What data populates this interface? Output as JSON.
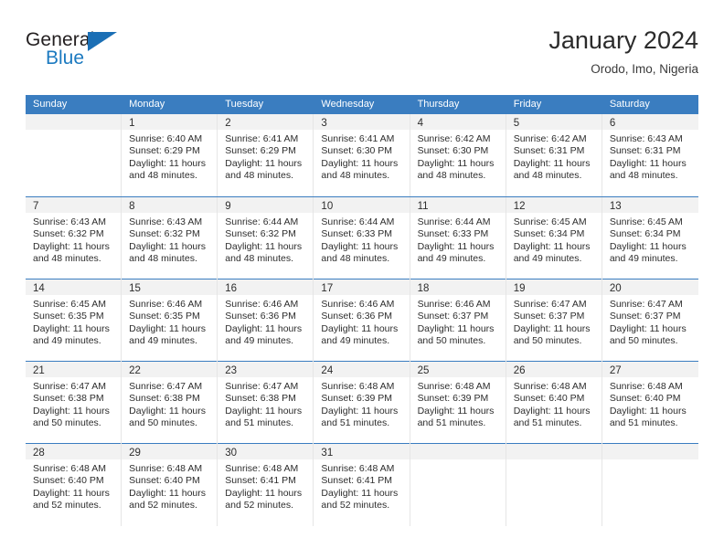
{
  "brand": {
    "name_part1": "General",
    "name_part2": "Blue",
    "logo_icon": "blue-triangle-logo"
  },
  "header": {
    "title": "January 2024",
    "location": "Orodo, Imo, Nigeria"
  },
  "calendar": {
    "weekday_headers": [
      "Sunday",
      "Monday",
      "Tuesday",
      "Wednesday",
      "Thursday",
      "Friday",
      "Saturday"
    ],
    "header_bg_color": "#3a7dc0",
    "daynum_band_color": "#f2f2f2",
    "weeks": [
      [
        {
          "day": "",
          "empty": true,
          "sunrise": "",
          "sunset": "",
          "daylight1": "",
          "daylight2": ""
        },
        {
          "day": "1",
          "sunrise": "Sunrise: 6:40 AM",
          "sunset": "Sunset: 6:29 PM",
          "daylight1": "Daylight: 11 hours",
          "daylight2": "and 48 minutes."
        },
        {
          "day": "2",
          "sunrise": "Sunrise: 6:41 AM",
          "sunset": "Sunset: 6:29 PM",
          "daylight1": "Daylight: 11 hours",
          "daylight2": "and 48 minutes."
        },
        {
          "day": "3",
          "sunrise": "Sunrise: 6:41 AM",
          "sunset": "Sunset: 6:30 PM",
          "daylight1": "Daylight: 11 hours",
          "daylight2": "and 48 minutes."
        },
        {
          "day": "4",
          "sunrise": "Sunrise: 6:42 AM",
          "sunset": "Sunset: 6:30 PM",
          "daylight1": "Daylight: 11 hours",
          "daylight2": "and 48 minutes."
        },
        {
          "day": "5",
          "sunrise": "Sunrise: 6:42 AM",
          "sunset": "Sunset: 6:31 PM",
          "daylight1": "Daylight: 11 hours",
          "daylight2": "and 48 minutes."
        },
        {
          "day": "6",
          "sunrise": "Sunrise: 6:43 AM",
          "sunset": "Sunset: 6:31 PM",
          "daylight1": "Daylight: 11 hours",
          "daylight2": "and 48 minutes."
        }
      ],
      [
        {
          "day": "7",
          "sunrise": "Sunrise: 6:43 AM",
          "sunset": "Sunset: 6:32 PM",
          "daylight1": "Daylight: 11 hours",
          "daylight2": "and 48 minutes."
        },
        {
          "day": "8",
          "sunrise": "Sunrise: 6:43 AM",
          "sunset": "Sunset: 6:32 PM",
          "daylight1": "Daylight: 11 hours",
          "daylight2": "and 48 minutes."
        },
        {
          "day": "9",
          "sunrise": "Sunrise: 6:44 AM",
          "sunset": "Sunset: 6:32 PM",
          "daylight1": "Daylight: 11 hours",
          "daylight2": "and 48 minutes."
        },
        {
          "day": "10",
          "sunrise": "Sunrise: 6:44 AM",
          "sunset": "Sunset: 6:33 PM",
          "daylight1": "Daylight: 11 hours",
          "daylight2": "and 48 minutes."
        },
        {
          "day": "11",
          "sunrise": "Sunrise: 6:44 AM",
          "sunset": "Sunset: 6:33 PM",
          "daylight1": "Daylight: 11 hours",
          "daylight2": "and 49 minutes."
        },
        {
          "day": "12",
          "sunrise": "Sunrise: 6:45 AM",
          "sunset": "Sunset: 6:34 PM",
          "daylight1": "Daylight: 11 hours",
          "daylight2": "and 49 minutes."
        },
        {
          "day": "13",
          "sunrise": "Sunrise: 6:45 AM",
          "sunset": "Sunset: 6:34 PM",
          "daylight1": "Daylight: 11 hours",
          "daylight2": "and 49 minutes."
        }
      ],
      [
        {
          "day": "14",
          "sunrise": "Sunrise: 6:45 AM",
          "sunset": "Sunset: 6:35 PM",
          "daylight1": "Daylight: 11 hours",
          "daylight2": "and 49 minutes."
        },
        {
          "day": "15",
          "sunrise": "Sunrise: 6:46 AM",
          "sunset": "Sunset: 6:35 PM",
          "daylight1": "Daylight: 11 hours",
          "daylight2": "and 49 minutes."
        },
        {
          "day": "16",
          "sunrise": "Sunrise: 6:46 AM",
          "sunset": "Sunset: 6:36 PM",
          "daylight1": "Daylight: 11 hours",
          "daylight2": "and 49 minutes."
        },
        {
          "day": "17",
          "sunrise": "Sunrise: 6:46 AM",
          "sunset": "Sunset: 6:36 PM",
          "daylight1": "Daylight: 11 hours",
          "daylight2": "and 49 minutes."
        },
        {
          "day": "18",
          "sunrise": "Sunrise: 6:46 AM",
          "sunset": "Sunset: 6:37 PM",
          "daylight1": "Daylight: 11 hours",
          "daylight2": "and 50 minutes."
        },
        {
          "day": "19",
          "sunrise": "Sunrise: 6:47 AM",
          "sunset": "Sunset: 6:37 PM",
          "daylight1": "Daylight: 11 hours",
          "daylight2": "and 50 minutes."
        },
        {
          "day": "20",
          "sunrise": "Sunrise: 6:47 AM",
          "sunset": "Sunset: 6:37 PM",
          "daylight1": "Daylight: 11 hours",
          "daylight2": "and 50 minutes."
        }
      ],
      [
        {
          "day": "21",
          "sunrise": "Sunrise: 6:47 AM",
          "sunset": "Sunset: 6:38 PM",
          "daylight1": "Daylight: 11 hours",
          "daylight2": "and 50 minutes."
        },
        {
          "day": "22",
          "sunrise": "Sunrise: 6:47 AM",
          "sunset": "Sunset: 6:38 PM",
          "daylight1": "Daylight: 11 hours",
          "daylight2": "and 50 minutes."
        },
        {
          "day": "23",
          "sunrise": "Sunrise: 6:47 AM",
          "sunset": "Sunset: 6:38 PM",
          "daylight1": "Daylight: 11 hours",
          "daylight2": "and 51 minutes."
        },
        {
          "day": "24",
          "sunrise": "Sunrise: 6:48 AM",
          "sunset": "Sunset: 6:39 PM",
          "daylight1": "Daylight: 11 hours",
          "daylight2": "and 51 minutes."
        },
        {
          "day": "25",
          "sunrise": "Sunrise: 6:48 AM",
          "sunset": "Sunset: 6:39 PM",
          "daylight1": "Daylight: 11 hours",
          "daylight2": "and 51 minutes."
        },
        {
          "day": "26",
          "sunrise": "Sunrise: 6:48 AM",
          "sunset": "Sunset: 6:40 PM",
          "daylight1": "Daylight: 11 hours",
          "daylight2": "and 51 minutes."
        },
        {
          "day": "27",
          "sunrise": "Sunrise: 6:48 AM",
          "sunset": "Sunset: 6:40 PM",
          "daylight1": "Daylight: 11 hours",
          "daylight2": "and 51 minutes."
        }
      ],
      [
        {
          "day": "28",
          "sunrise": "Sunrise: 6:48 AM",
          "sunset": "Sunset: 6:40 PM",
          "daylight1": "Daylight: 11 hours",
          "daylight2": "and 52 minutes."
        },
        {
          "day": "29",
          "sunrise": "Sunrise: 6:48 AM",
          "sunset": "Sunset: 6:40 PM",
          "daylight1": "Daylight: 11 hours",
          "daylight2": "and 52 minutes."
        },
        {
          "day": "30",
          "sunrise": "Sunrise: 6:48 AM",
          "sunset": "Sunset: 6:41 PM",
          "daylight1": "Daylight: 11 hours",
          "daylight2": "and 52 minutes."
        },
        {
          "day": "31",
          "sunrise": "Sunrise: 6:48 AM",
          "sunset": "Sunset: 6:41 PM",
          "daylight1": "Daylight: 11 hours",
          "daylight2": "and 52 minutes."
        },
        {
          "day": "",
          "empty": true,
          "sunrise": "",
          "sunset": "",
          "daylight1": "",
          "daylight2": ""
        },
        {
          "day": "",
          "empty": true,
          "sunrise": "",
          "sunset": "",
          "daylight1": "",
          "daylight2": ""
        },
        {
          "day": "",
          "empty": true,
          "sunrise": "",
          "sunset": "",
          "daylight1": "",
          "daylight2": ""
        }
      ]
    ]
  }
}
